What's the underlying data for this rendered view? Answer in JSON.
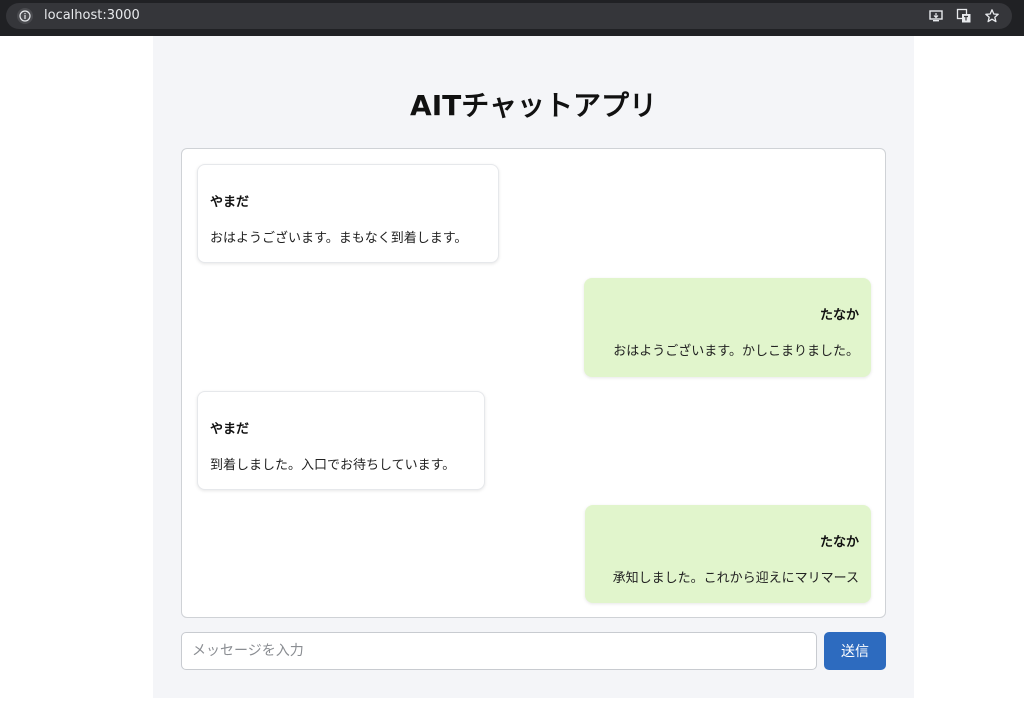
{
  "browser": {
    "url": "localhost:3000"
  },
  "app": {
    "title": "AITチャットアプリ"
  },
  "messages": [
    {
      "sender": "やまだ",
      "text": "おはようございます。まもなく到着します。",
      "side": "left"
    },
    {
      "sender": "たなか",
      "text": "おはようございます。かしこまりました。",
      "side": "right"
    },
    {
      "sender": "やまだ",
      "text": "到着しました。入口でお待ちしています。",
      "side": "left"
    },
    {
      "sender": "たなか",
      "text": "承知しました。これから迎えにマリマース",
      "side": "right"
    }
  ],
  "input": {
    "placeholder": "メッセージを入力",
    "value": ""
  },
  "send_button": {
    "label": "送信"
  },
  "colors": {
    "accent": "#2d6bbf",
    "own_bubble": "#e1f5cc",
    "panel_bg": "#f4f5f8"
  }
}
